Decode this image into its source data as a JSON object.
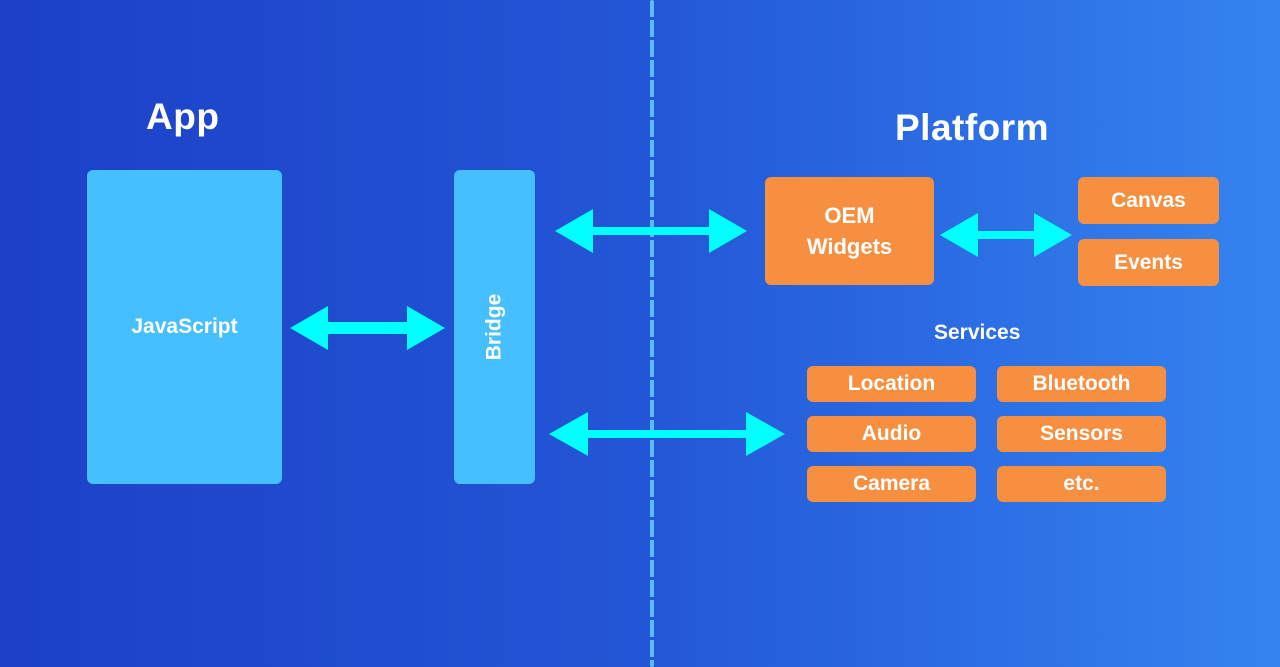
{
  "diagram": {
    "colors": {
      "background_left": "#1c40c6",
      "background_right": "#3484f0",
      "app_box": "#45bffe",
      "platform_box": "#f68f40",
      "arrow": "#00ffff",
      "divider": "#5cbcf2",
      "text": "#ffffff"
    },
    "app": {
      "title": "App",
      "javascript_label": "JavaScript",
      "bridge_label": "Bridge"
    },
    "platform": {
      "title": "Platform",
      "oem_widgets_label": "OEM\nWidgets",
      "canvas_label": "Canvas",
      "events_label": "Events",
      "services": {
        "title": "Services",
        "items": [
          "Location",
          "Bluetooth",
          "Audio",
          "Sensors",
          "Camera",
          "etc."
        ]
      }
    },
    "connections": [
      {
        "from": "JavaScript",
        "to": "Bridge",
        "direction": "bidirectional"
      },
      {
        "from": "Bridge",
        "to": "OEM Widgets",
        "direction": "bidirectional"
      },
      {
        "from": "OEM Widgets",
        "to": "Canvas/Events",
        "direction": "bidirectional"
      },
      {
        "from": "Bridge",
        "to": "Services",
        "direction": "bidirectional"
      }
    ]
  }
}
